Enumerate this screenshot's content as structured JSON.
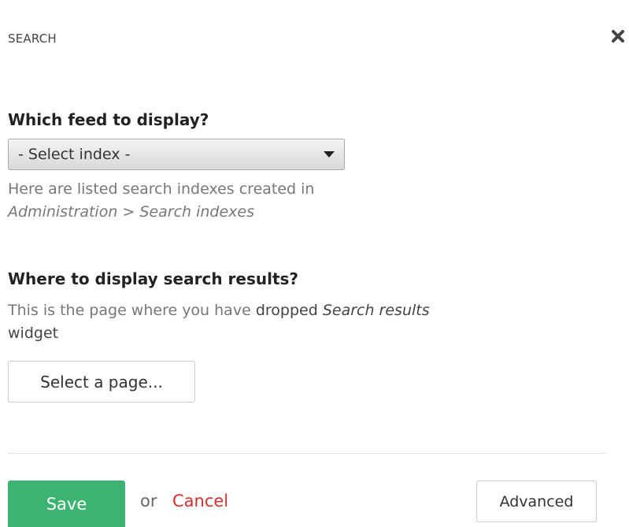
{
  "header": {
    "title": "SEARCH",
    "close_icon": "close-icon"
  },
  "feed": {
    "label": "Which feed to display?",
    "select_value": "- Select index -",
    "help_line1": "Here are listed search indexes created in",
    "help_line2": "Administration > Search indexes"
  },
  "results": {
    "label": "Where to display search results?",
    "help_part1": "This is the page where you have ",
    "help_part2": "dropped",
    "help_part3": " ",
    "help_part4": "Search results",
    "help_part5": "widget",
    "page_button_label": "Select a page..."
  },
  "footer": {
    "save_label": "Save",
    "or_text": "or",
    "cancel_label": "Cancel",
    "advanced_label": "Advanced"
  },
  "colors": {
    "save": "#3cb371",
    "cancel": "#d32f2f"
  }
}
